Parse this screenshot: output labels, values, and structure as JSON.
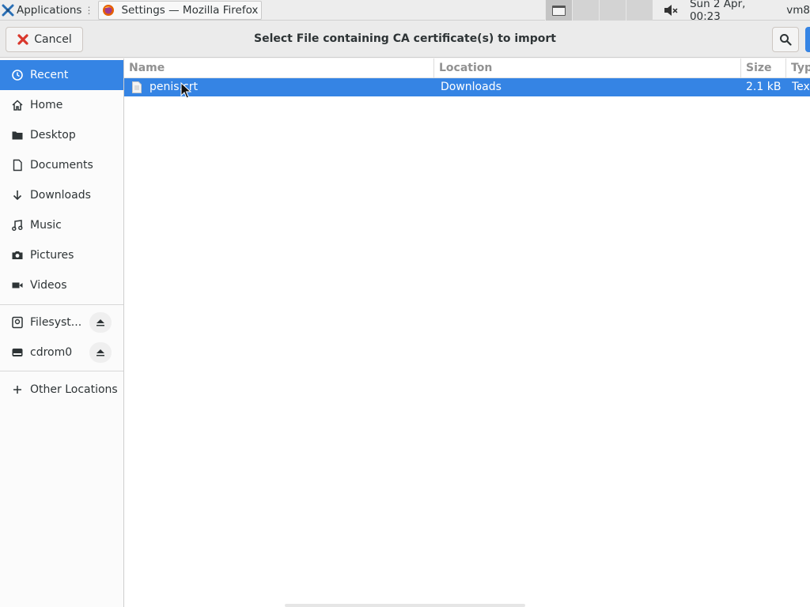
{
  "panel": {
    "applications_label": "Applications",
    "applications_sep": "⋮",
    "task_title": "Settings — Mozilla Firefox",
    "clock": "Sun  2 Apr, 00:23",
    "host": "vm8"
  },
  "dialog": {
    "title": "Select File containing CA certificate(s) to import",
    "cancel_label": "Cancel",
    "accent_color": "#3584e4"
  },
  "sidebar": {
    "items": [
      {
        "label": "Recent",
        "icon": "recent-icon"
      },
      {
        "label": "Home",
        "icon": "home-icon"
      },
      {
        "label": "Desktop",
        "icon": "desktop-folder-icon"
      },
      {
        "label": "Documents",
        "icon": "document-icon"
      },
      {
        "label": "Downloads",
        "icon": "download-icon"
      },
      {
        "label": "Music",
        "icon": "music-icon"
      },
      {
        "label": "Pictures",
        "icon": "camera-icon"
      },
      {
        "label": "Videos",
        "icon": "video-icon"
      }
    ],
    "devices": [
      {
        "label": "Filesyst...",
        "icon": "drive-icon"
      },
      {
        "label": "cdrom0",
        "icon": "optical-drive-icon"
      }
    ],
    "other_locations": "Other Locations"
  },
  "table": {
    "columns": [
      "Name",
      "Location",
      "Size",
      "Typ"
    ],
    "rows": [
      {
        "name": "penis.crt",
        "location": "Downloads",
        "size": "2.1 kB",
        "type": "Tex"
      }
    ]
  }
}
